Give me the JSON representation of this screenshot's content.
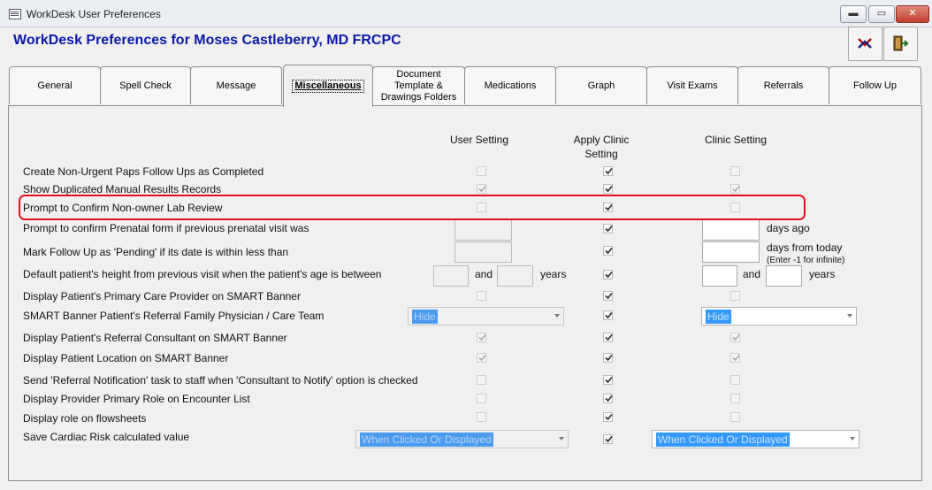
{
  "window": {
    "title": "WorkDesk User Preferences",
    "minimize": "▬",
    "maximize": "▭",
    "close": "✕"
  },
  "header": {
    "title": "WorkDesk Preferences for Moses  Castleberry, MD FRCPC"
  },
  "tabs": [
    {
      "label": "General"
    },
    {
      "label": "Spell Check"
    },
    {
      "label": "Message"
    },
    {
      "label": "Miscellaneous",
      "active": true
    },
    {
      "label": "Document Template & Drawings Folders"
    },
    {
      "label": "Medications"
    },
    {
      "label": "Graph"
    },
    {
      "label": "Visit Exams"
    },
    {
      "label": "Referrals"
    },
    {
      "label": "Follow Up"
    }
  ],
  "columns": {
    "user": "User Setting",
    "apply_line1": "Apply Clinic",
    "apply_line2": "Setting",
    "clinic": "Clinic Setting"
  },
  "rows": [
    {
      "label": "Create Non-Urgent Paps Follow Ups as Completed",
      "user": false,
      "apply": true,
      "clinic": false
    },
    {
      "label": "Show Duplicated Manual Results Records",
      "user": true,
      "apply": true,
      "clinic": true
    },
    {
      "label": "Prompt to Confirm Non-owner Lab Review",
      "user": false,
      "apply": true,
      "clinic": false
    },
    {
      "label": "Prompt to confirm Prenatal form if previous prenatal visit was",
      "apply": true,
      "unit": "days ago"
    },
    {
      "label": "Mark Follow Up as 'Pending' if its date is within less than",
      "apply": true,
      "unit": "days from today",
      "hint": "(Enter -1 for infinite)"
    },
    {
      "label": "Default patient's height from previous visit when the patient's age is between",
      "apply": true,
      "and": "and",
      "years": "years"
    },
    {
      "label": "Display Patient's Primary Care Provider on SMART Banner",
      "user": false,
      "apply": true,
      "clinic": false
    },
    {
      "label": "SMART Banner Patient's Referral Family Physician / Care Team",
      "apply": true,
      "user_select": "Hide",
      "clinic_select": "Hide"
    },
    {
      "label": "Display Patient's Referral Consultant on SMART Banner",
      "user": true,
      "apply": true,
      "clinic": true
    },
    {
      "label": "Display Patient Location on  SMART Banner",
      "user": true,
      "apply": true,
      "clinic": true
    },
    {
      "label": "Send 'Referral Notification' task to staff when 'Consultant to Notify' option is checked",
      "user": false,
      "apply": true,
      "clinic": false
    },
    {
      "label": "Display Provider Primary Role on Encounter List",
      "user": false,
      "apply": true,
      "clinic": false
    },
    {
      "label": "Display role on flowsheets",
      "user": false,
      "apply": true,
      "clinic": false
    },
    {
      "label": "Save Cardiac Risk calculated value",
      "apply": true,
      "user_select": "When Clicked Or Displayed",
      "clinic_select": "When Clicked Or Displayed"
    }
  ],
  "colors": {
    "heading": "#0a1aa8",
    "highlight": "#e8101c",
    "selection": "#3399ff"
  }
}
